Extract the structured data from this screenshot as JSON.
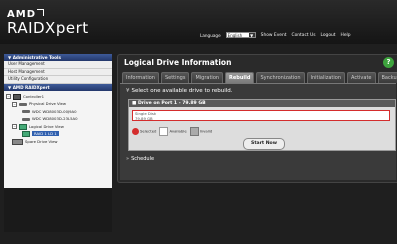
{
  "brand": {
    "company": "AMD",
    "product": "RAIDXpert"
  },
  "topnav": {
    "language_label": "Language",
    "language_value": "English",
    "links": [
      "Show Event",
      "Contact Us",
      "Logout",
      "Help"
    ]
  },
  "leftpanel": {
    "admin_title": "Administrative Tools",
    "admin_items": [
      "User Management",
      "Host Management",
      "Utility Configuration"
    ],
    "raid_title": "AMD RAIDXpert",
    "tree": [
      {
        "label": "Controller1",
        "icon": "controller-icon",
        "indent": 0
      },
      {
        "label": "Physical Drive View",
        "icon": "disk-icon",
        "indent": 1
      },
      {
        "label": "WDC WD8003D-00J9A0",
        "icon": "disk-icon",
        "indent": 2
      },
      {
        "label": "WDC WD8003D-23L5A0",
        "icon": "disk-icon",
        "indent": 2
      },
      {
        "label": "Logical Drive View",
        "icon": "logical-drive-icon",
        "indent": 1
      },
      {
        "label": "RAID 1 LD 1",
        "icon": "logical-drive-icon",
        "indent": 2,
        "selected": true
      },
      {
        "label": "Spare Drive View",
        "icon": "spare-icon",
        "indent": 1
      }
    ]
  },
  "main": {
    "title": "Logical Drive Information",
    "tabs": [
      "Information",
      "Settings",
      "Migration",
      "Rebuild",
      "Synchronization",
      "Initialization",
      "Activate",
      "Backup"
    ],
    "active_tab": "Rebuild",
    "section_title": "Select one available drive to rebuild.",
    "drive_header": "Drive on Port 1 - 79.89 GB",
    "drive_line1": "Single Disk",
    "drive_line2": "79.89 GB",
    "legend": [
      "Selected",
      "Available",
      "Invalid"
    ],
    "start_button": "Start Now",
    "schedule_label": "Schedule"
  },
  "colors": {
    "accent_blue": "#2f5fae",
    "selected_red": "#d42d2d",
    "help_green": "#3da33d"
  }
}
